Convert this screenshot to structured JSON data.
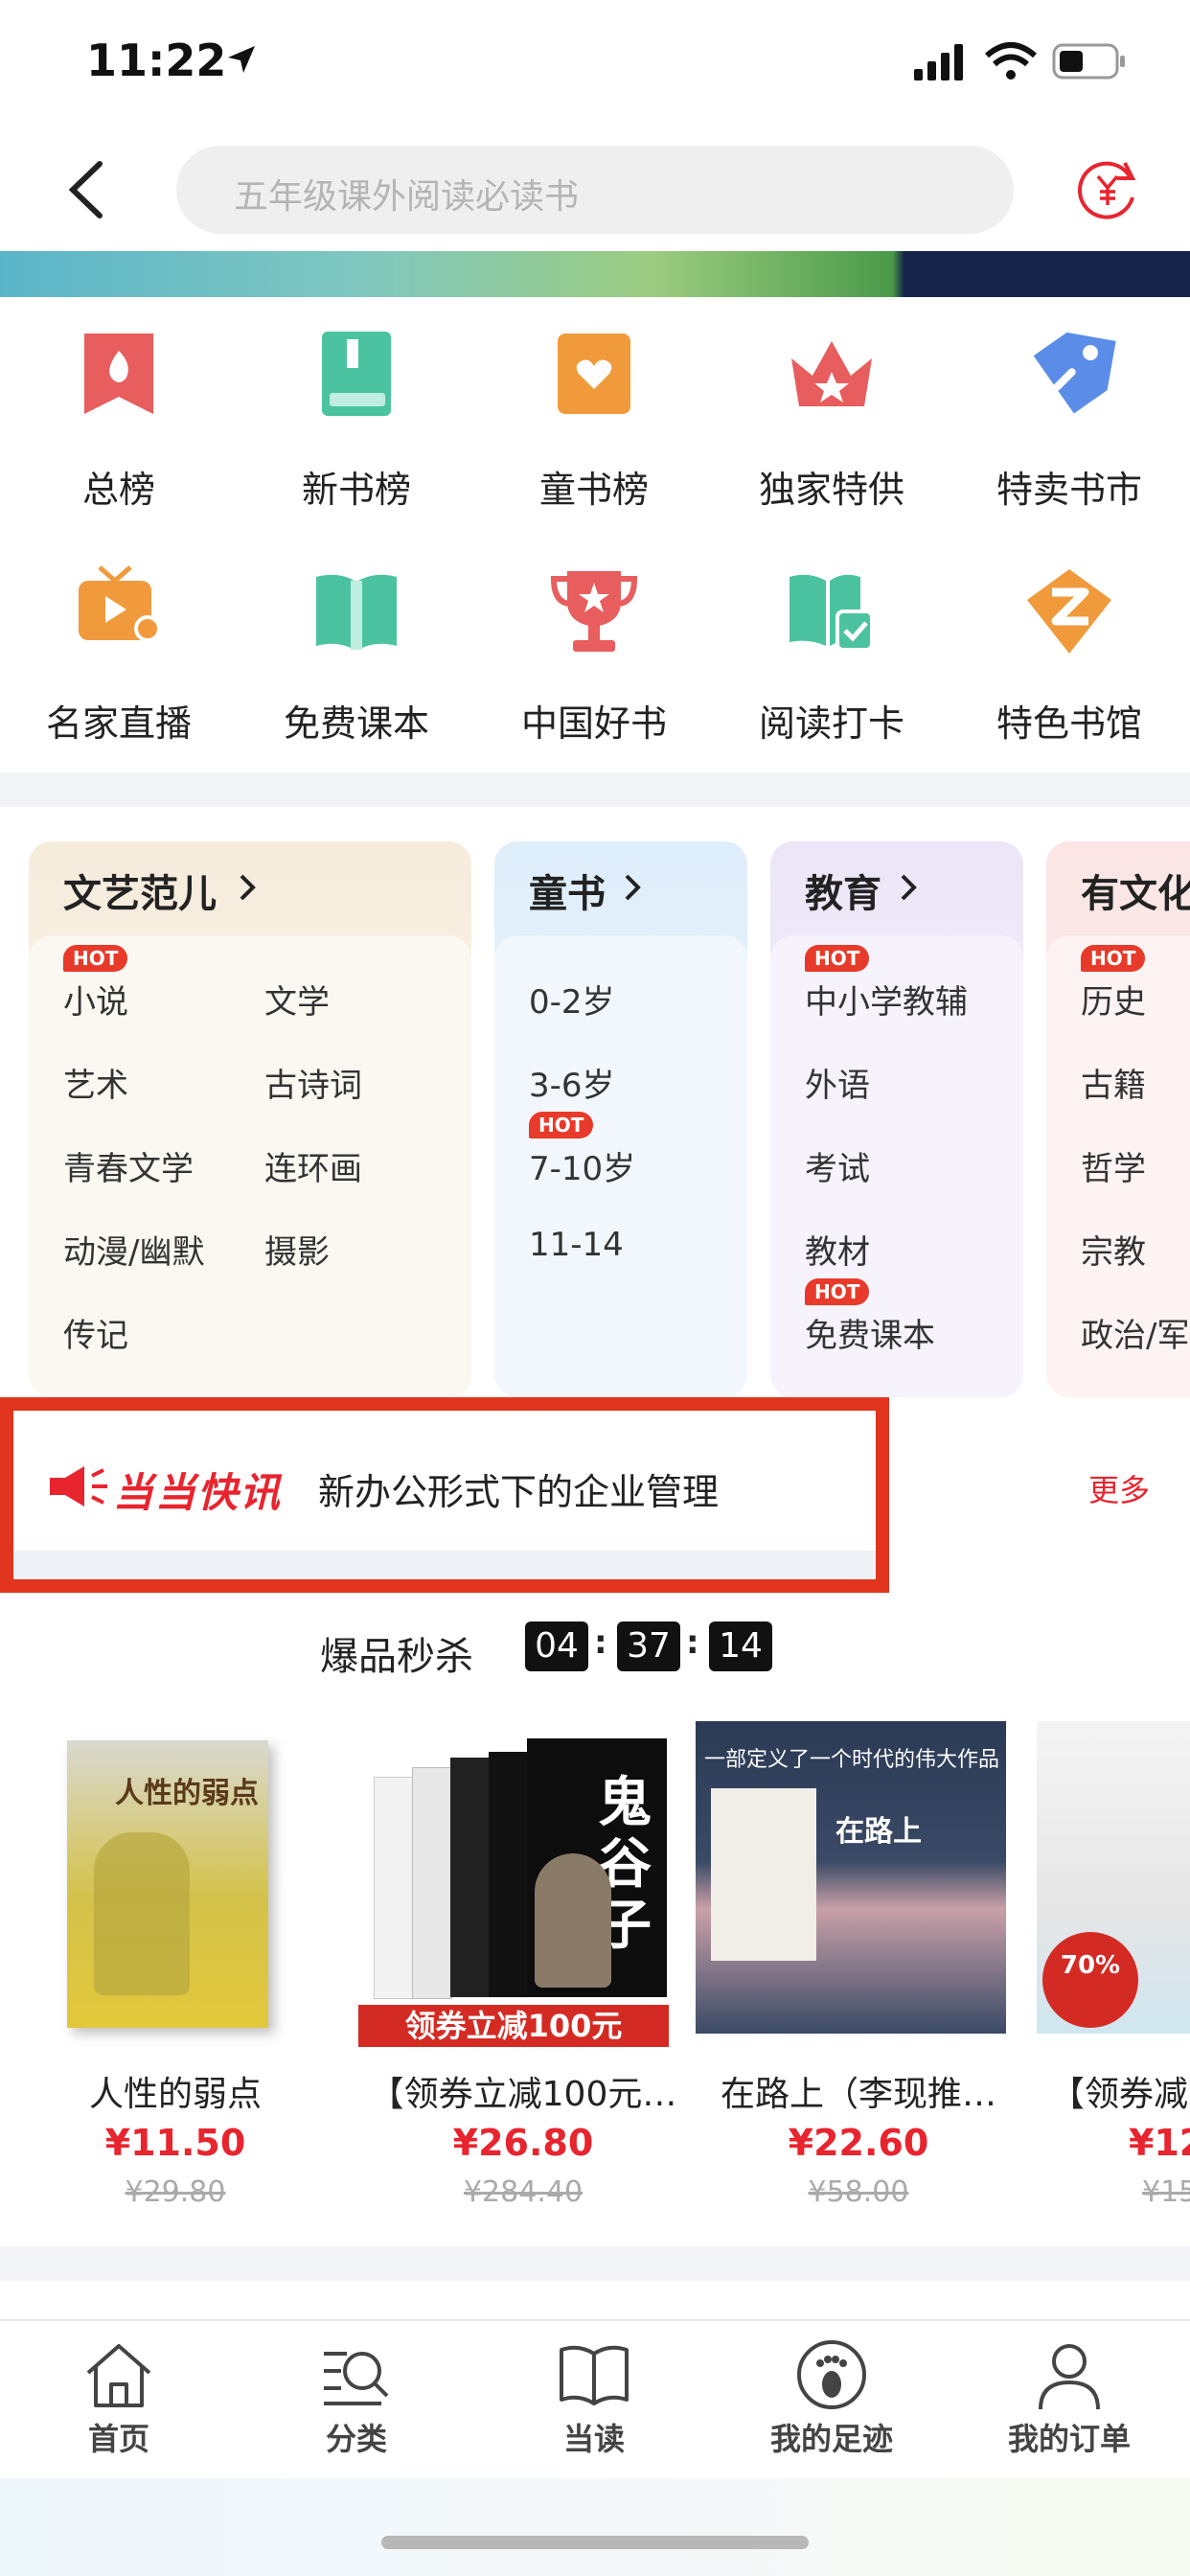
{
  "status_bar": {
    "time": "11:22"
  },
  "search": {
    "placeholder": "五年级课外阅读必读书"
  },
  "grid": [
    {
      "label": "总榜",
      "icon": "flame-flag-icon"
    },
    {
      "label": "新书榜",
      "icon": "new-book-icon"
    },
    {
      "label": "童书榜",
      "icon": "heart-book-icon"
    },
    {
      "label": "独家特供",
      "icon": "crown-icon"
    },
    {
      "label": "特卖书市",
      "icon": "price-tag-icon"
    },
    {
      "label": "名家直播",
      "icon": "live-tv-icon"
    },
    {
      "label": "免费课本",
      "icon": "open-book-icon"
    },
    {
      "label": "中国好书",
      "icon": "trophy-icon"
    },
    {
      "label": "阅读打卡",
      "icon": "checkin-book-icon"
    },
    {
      "label": "特色书馆",
      "icon": "z-badge-icon"
    }
  ],
  "categories": {
    "wenyi": {
      "title": "文艺范儿",
      "col1": [
        "小说",
        "艺术",
        "青春文学",
        "动漫/幽默",
        "传记"
      ],
      "col2": [
        "文学",
        "古诗词",
        "连环画",
        "摄影"
      ]
    },
    "tongshu": {
      "title": "童书",
      "items": [
        "0-2岁",
        "3-6岁",
        "7-10岁",
        "11-14"
      ]
    },
    "jiaoyu": {
      "title": "教育",
      "items": [
        "中小学教辅",
        "外语",
        "考试",
        "教材",
        "免费课本"
      ]
    },
    "youwenhua": {
      "title": "有文化",
      "items": [
        "历史",
        "古籍",
        "哲学",
        "宗教",
        "政治/军事"
      ]
    },
    "hot_label": "HOT"
  },
  "news": {
    "brand": "当当快讯",
    "headline": "新办公形式下的企业管理",
    "more": "更多"
  },
  "flash_sale": {
    "title": "爆品秒杀",
    "countdown": [
      "04",
      "37",
      "14"
    ],
    "books": [
      {
        "title": "人性的弱点",
        "price": "¥11.50",
        "old_price": "¥29.80",
        "cover_title": "人性的弱点"
      },
      {
        "title": "【领券立减100元…",
        "price": "¥26.80",
        "old_price": "¥284.40",
        "cover_title": "鬼谷子",
        "cover_banner": "领券立减100元"
      },
      {
        "title": "在路上（李现推…",
        "price": "¥22.60",
        "old_price": "¥58.00",
        "cover_title": "在路上",
        "cover_top": "一部定义了一个时代的伟大作品"
      },
      {
        "title": "【领券减",
        "price": "¥12",
        "old_price": "¥15",
        "cover_badge": "70%"
      }
    ]
  },
  "tabs": [
    {
      "label": "首页",
      "icon": "home-icon"
    },
    {
      "label": "分类",
      "icon": "category-search-icon"
    },
    {
      "label": "当读",
      "icon": "book-icon"
    },
    {
      "label": "我的足迹",
      "icon": "footprint-icon"
    },
    {
      "label": "我的订单",
      "icon": "user-icon"
    }
  ],
  "colors": {
    "accent": "#e8242e",
    "news_frame": "#e0341e",
    "icon_red": "#e85d5d",
    "icon_green": "#4cc3a0",
    "icon_orange": "#f09a3c",
    "icon_blue": "#5b8de8"
  }
}
